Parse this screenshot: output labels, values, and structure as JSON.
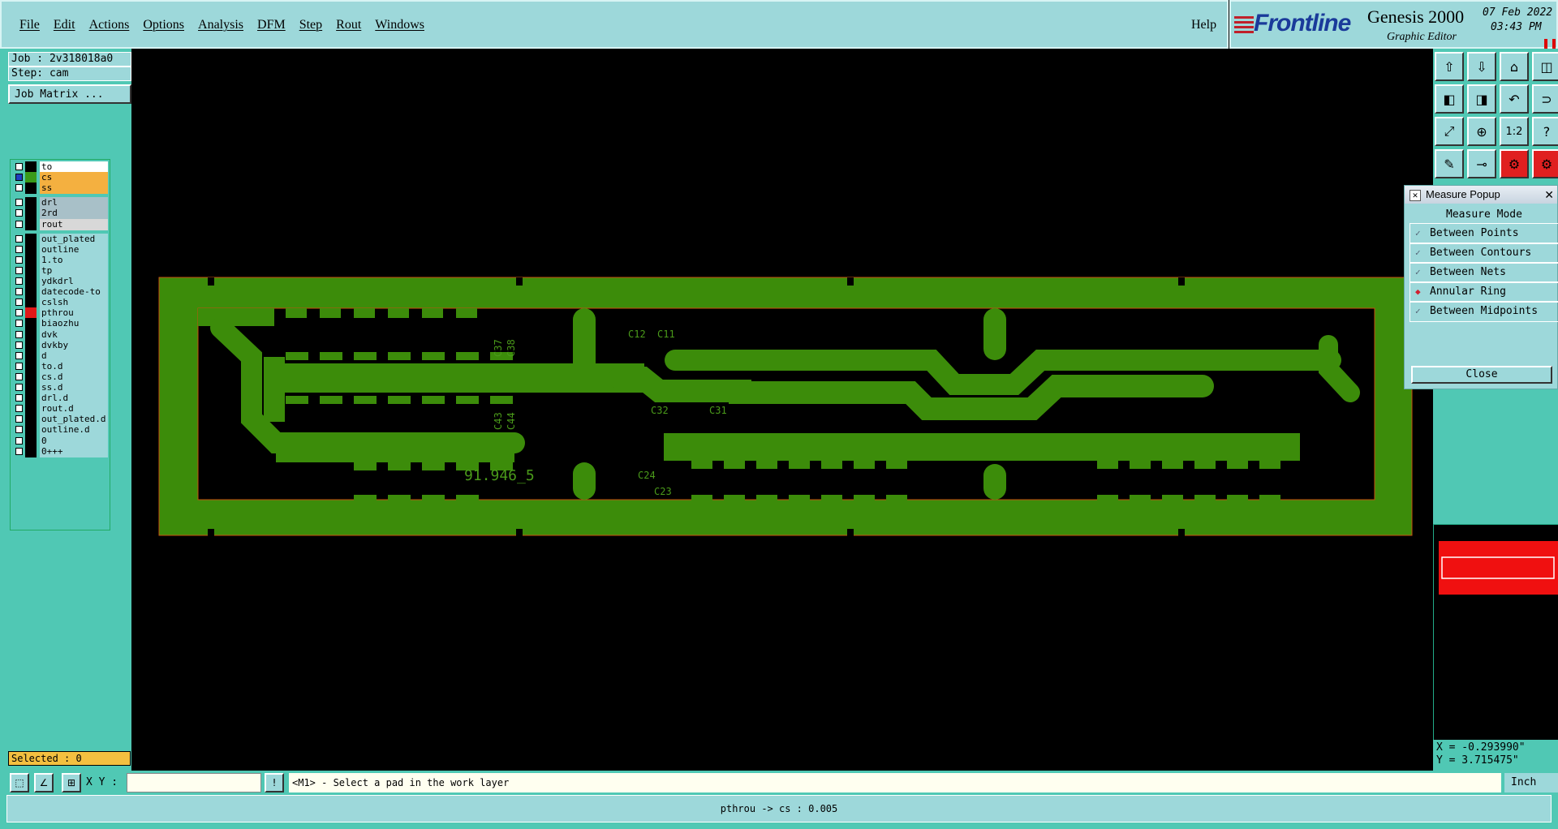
{
  "menu": {
    "items": [
      "File",
      "Edit",
      "Actions",
      "Options",
      "Analysis",
      "DFM",
      "Step",
      "Rout",
      "Windows"
    ],
    "help": "Help"
  },
  "brand": {
    "logo": "Frontline",
    "product": "Genesis 2000",
    "subtitle": "Graphic Editor",
    "date": "07 Feb 2022",
    "time": "03:43 PM"
  },
  "job": {
    "job_label": "Job : 2v318018a0",
    "step_label": "Step: cam",
    "matrix_button": "Job Matrix ..."
  },
  "layers": [
    {
      "name": "to",
      "state": "selected",
      "color": "#000000"
    },
    {
      "name": "cs",
      "state": "work",
      "color": "#3a9a1a"
    },
    {
      "name": "ss",
      "state": "orange",
      "color": "#000000"
    },
    {
      "name": "drl",
      "state": "gray",
      "color": "#000000"
    },
    {
      "name": "2rd",
      "state": "gray",
      "color": "#000000"
    },
    {
      "name": "rout",
      "state": "lightgray",
      "color": "#000000"
    },
    {
      "name": "out_plated",
      "state": "normal",
      "color": "#000000"
    },
    {
      "name": "outline",
      "state": "normal",
      "color": "#000000"
    },
    {
      "name": "1.to",
      "state": "normal",
      "color": "#000000"
    },
    {
      "name": "tp",
      "state": "normal",
      "color": "#000000"
    },
    {
      "name": "ydkdrl",
      "state": "normal",
      "color": "#000000"
    },
    {
      "name": "datecode-to",
      "state": "normal",
      "color": "#000000"
    },
    {
      "name": "cslsh",
      "state": "normal",
      "color": "#000000"
    },
    {
      "name": "pthrou",
      "state": "normal",
      "color": "#e01818"
    },
    {
      "name": "biaozhu",
      "state": "normal",
      "color": "#000000"
    },
    {
      "name": "dvk",
      "state": "normal",
      "color": "#000000"
    },
    {
      "name": "dvkby",
      "state": "normal",
      "color": "#000000"
    },
    {
      "name": "d",
      "state": "normal",
      "color": "#000000"
    },
    {
      "name": "to.d",
      "state": "normal",
      "color": "#000000"
    },
    {
      "name": "cs.d",
      "state": "normal",
      "color": "#000000"
    },
    {
      "name": "ss.d",
      "state": "normal",
      "color": "#000000"
    },
    {
      "name": "drl.d",
      "state": "normal",
      "color": "#000000"
    },
    {
      "name": "rout.d",
      "state": "normal",
      "color": "#000000"
    },
    {
      "name": "out_plated.d",
      "state": "normal",
      "color": "#000000"
    },
    {
      "name": "outline.d",
      "state": "normal",
      "color": "#000000"
    },
    {
      "name": "0",
      "state": "normal",
      "color": "#000000"
    },
    {
      "name": "0+++",
      "state": "normal",
      "color": "#000000"
    }
  ],
  "selected_label": "Selected : 0",
  "canvas": {
    "copper_color": "#3c8c0a",
    "text_color": "#4a9a1a",
    "labels": [
      "C37",
      "C38",
      "C12",
      "C11",
      "C43",
      "C44",
      "C32",
      "C31",
      "C24",
      "C23",
      "91.946_5"
    ]
  },
  "measure_popup": {
    "title": "Measure Popup",
    "header": "Measure Mode",
    "options": [
      {
        "label": "Between Points",
        "active": false
      },
      {
        "label": "Between Contours",
        "active": false
      },
      {
        "label": "Between Nets",
        "active": false
      },
      {
        "label": "Annular Ring",
        "active": true
      },
      {
        "label": "Between Midpoints",
        "active": false
      }
    ],
    "close_label": "Close"
  },
  "toolbar_icons": [
    "layer-up-icon",
    "layer-down-icon",
    "home-icon",
    "split-view-icon",
    "pan-left-icon",
    "pan-right-icon",
    "undo-icon",
    "snap-icon",
    "zoom-fit-icon",
    "zoom-icon",
    "ratio-icon",
    "help-icon",
    "measure-icon",
    "pad-icon",
    "net-icon",
    "net2-icon"
  ],
  "toolbar_ratio_text": "1:2",
  "coords": {
    "x": "X = -0.293990\"",
    "y": "Y = 3.715475\""
  },
  "command": {
    "xy_label": "X Y :",
    "xy_value": "",
    "prompt": "<M1> - Select a pad in the work layer",
    "units": "Inch"
  },
  "status": "pthrou -> cs : 0.005"
}
